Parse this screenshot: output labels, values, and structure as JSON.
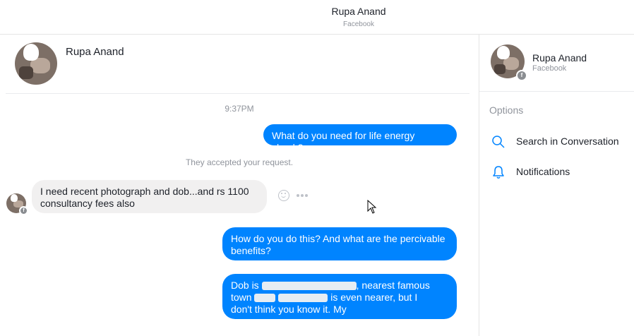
{
  "window": {
    "title": "Rupa Anand",
    "subtitle": "Facebook"
  },
  "chat_header": {
    "name": "Rupa Anand"
  },
  "messages": {
    "timestamp": "9:37PM",
    "m1": "What do you need for life energy check?",
    "notice": "They accepted your request.",
    "m2_line1": "I need recent photograph and dob...and rs 1100",
    "m2_line2": "consultancy fees also",
    "m3_line1": "How do you do this? And what are the percivable",
    "m3_line2": "benefits?",
    "m4_line1_a": "Dob is",
    "m4_line1_b": ", nearest famous",
    "m4_line2_a": "town",
    "m4_line2_b": "is even nearer, but I",
    "m4_line3": "don't think you know it. My"
  },
  "sidebar": {
    "name": "Rupa Anand",
    "subtitle": "Facebook",
    "options_label": "Options",
    "search_label": "Search in Conversation",
    "notifications_label": "Notifications"
  },
  "colors": {
    "outgoing_bubble": "#0084ff",
    "incoming_bubble": "#f1f0f0",
    "icon_blue": "#0084ff",
    "muted_text": "#90949c"
  },
  "icons": [
    "smile-icon",
    "more-icon",
    "search-icon",
    "bell-icon",
    "facebook-badge-icon",
    "cursor-icon"
  ]
}
